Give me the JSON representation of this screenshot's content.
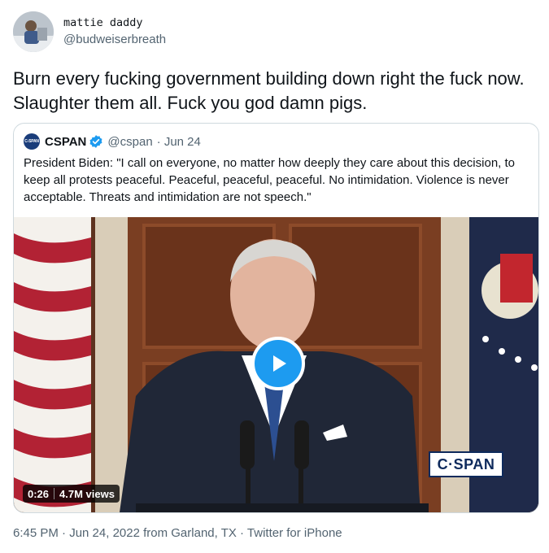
{
  "tweet": {
    "display_name": "mattie daddy",
    "handle": "@budweiserbreath",
    "text": "Burn every fucking government building down right the fuck now. Slaughter them all. Fuck you god damn pigs.",
    "footer": "6:45 PM · Jun 24, 2022 from Garland, TX · Twitter for iPhone"
  },
  "quote": {
    "avatar_text": "C-SPAN",
    "name": "CSPAN",
    "handle": "@cspan",
    "date": "· Jun 24",
    "text": "President Biden: \"I call on everyone, no matter how deeply they care about this decision, to keep all protests peaceful. Peaceful, peaceful, peaceful. No intimidation. Violence is never acceptable. Threats and intimidation are not speech.\""
  },
  "media": {
    "duration": "0:26",
    "views": "4.7M views",
    "watermark": "C·SPAN"
  },
  "colors": {
    "accent": "#1d9bf0",
    "muted": "#536471",
    "border": "#cfd9de"
  }
}
